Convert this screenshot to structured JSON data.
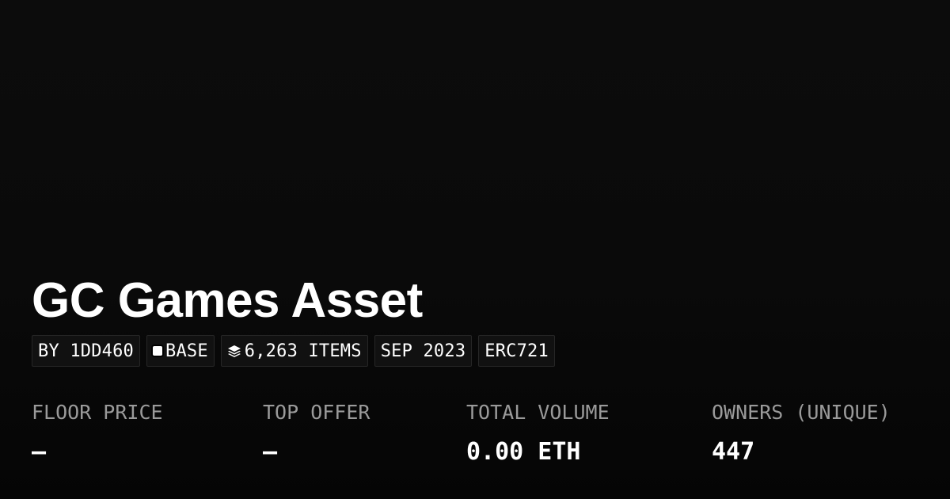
{
  "collection": {
    "title": "GC Games Asset"
  },
  "tags": {
    "creator": "BY 1DD460",
    "chain": "BASE",
    "chain_icon": "chain-square-icon",
    "items": "6,263 ITEMS",
    "items_icon": "layers-icon",
    "date": "SEP 2023",
    "standard": "ERC721"
  },
  "stats": {
    "floor_price": {
      "label": "FLOOR PRICE",
      "value": "–"
    },
    "top_offer": {
      "label": "TOP OFFER",
      "value": "–"
    },
    "total_volume": {
      "label": "TOTAL VOLUME",
      "value": "0.00 ETH"
    },
    "owners": {
      "label": "OWNERS (UNIQUE)",
      "value": "447"
    }
  },
  "colors": {
    "background": "#0a0a0a",
    "text": "#ffffff",
    "muted": "#9a9a9a",
    "tag_border": "#262626",
    "tag_bg": "#111111"
  }
}
